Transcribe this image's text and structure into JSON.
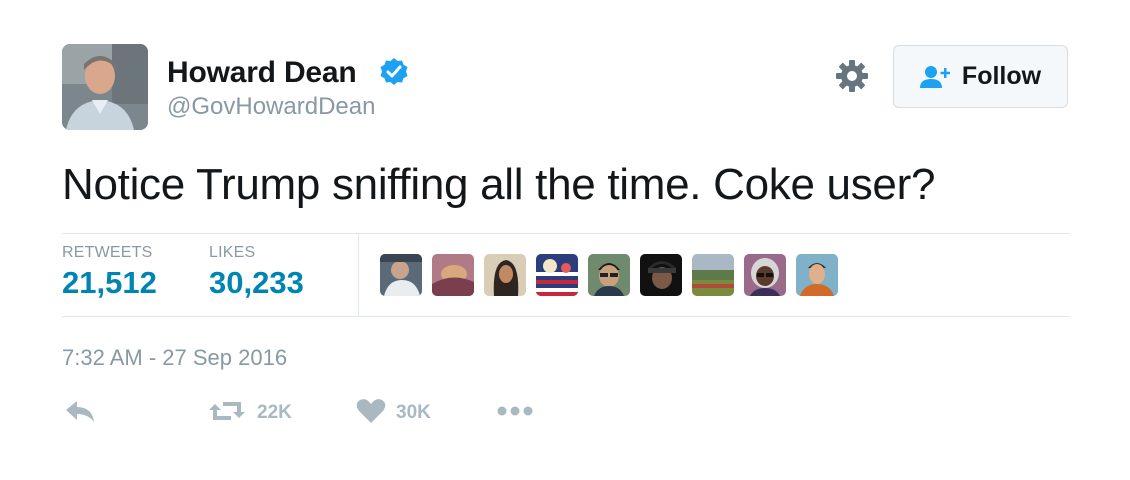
{
  "user": {
    "display_name": "Howard Dean",
    "screen_name": "@GovHowardDean",
    "verified_icon": "verified-badge-icon"
  },
  "follow_button": {
    "label": "Follow",
    "icon": "follow-user-plus-icon"
  },
  "settings_icon": "gear-icon",
  "tweet": {
    "text": "Notice Trump sniffing all the time. Coke user?",
    "timestamp": "7:32 AM - 27 Sep 2016"
  },
  "stats": {
    "retweets_label": "RETWEETS",
    "retweets_value": "21,512",
    "likes_label": "LIKES",
    "likes_value": "30,233"
  },
  "actions": {
    "reply_icon": "reply-icon",
    "retweet_icon": "retweet-icon",
    "retweet_count": "22K",
    "like_icon": "heart-icon",
    "like_count": "30K",
    "more_icon": "more-dots-icon"
  },
  "colors": {
    "link_blue": "#0084b4",
    "verified_blue": "#1da1f2",
    "muted_gray": "#8899a6",
    "icon_gray": "#aab8c2",
    "text_dark": "#14171a",
    "divider": "#e1e8ed"
  }
}
